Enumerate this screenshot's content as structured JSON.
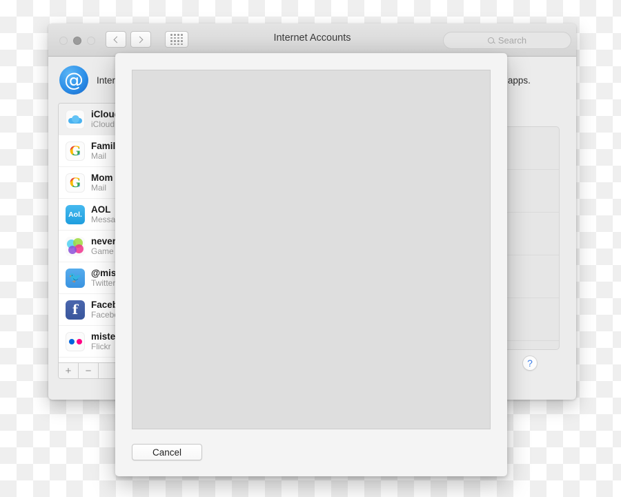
{
  "window": {
    "title": "Internet Accounts",
    "traffic_lights": [
      "close",
      "minimize",
      "maximize"
    ],
    "toolbar": {
      "back_label": "Back",
      "forward_label": "Forward",
      "show_all_label": "Show All",
      "search_placeholder": "Search",
      "search_value": ""
    },
    "header": {
      "icon": "at-sign-icon",
      "description": "Internet Accounts sets up your accounts to use with Mail, Contacts, Calendar, Messages, and other apps."
    },
    "sidebar": {
      "accounts": [
        {
          "name": "iCloud",
          "service": "iCloud",
          "icon": "icloud-icon",
          "selected": true
        },
        {
          "name": "Family",
          "service": "Mail",
          "icon": "google-icon",
          "selected": false
        },
        {
          "name": "Mom",
          "service": "Mail",
          "icon": "google-icon",
          "selected": false
        },
        {
          "name": "AOL",
          "service": "Messages",
          "icon": "aol-icon",
          "selected": false
        },
        {
          "name": "never",
          "service": "Game Center",
          "icon": "gamecenter-icon",
          "selected": false
        },
        {
          "name": "@miss",
          "service": "Twitter",
          "icon": "twitter-icon",
          "selected": false
        },
        {
          "name": "Facebook",
          "service": "Facebook",
          "icon": "facebook-icon",
          "selected": false
        },
        {
          "name": "mister",
          "service": "Flickr",
          "icon": "flickr-icon",
          "selected": false
        }
      ],
      "add_label": "+",
      "remove_label": "−"
    },
    "detail": {
      "row_count": 6,
      "help_label": "?",
      "accent_color": "#3b7de8"
    }
  },
  "sheet": {
    "cancel_label": "Cancel",
    "content_placeholder": ""
  }
}
